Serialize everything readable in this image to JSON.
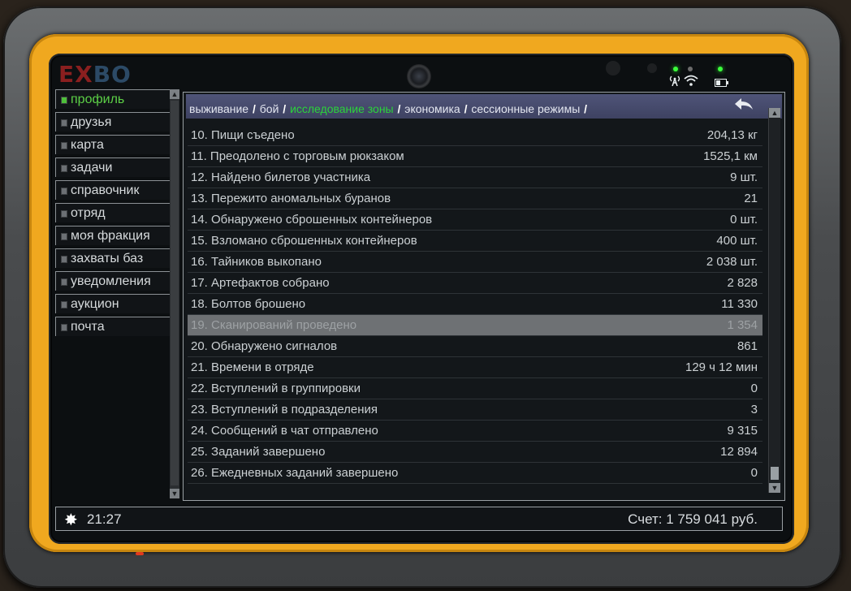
{
  "brand": {
    "ex": "EX",
    "bo": "BO"
  },
  "sidebar": {
    "items": [
      {
        "label": "профиль"
      },
      {
        "label": "друзья"
      },
      {
        "label": "карта"
      },
      {
        "label": "задачи"
      },
      {
        "label": "справочник"
      },
      {
        "label": "отряд"
      },
      {
        "label": "моя фракция"
      },
      {
        "label": "захваты баз"
      },
      {
        "label": "уведомления"
      },
      {
        "label": "аукцион"
      },
      {
        "label": "почта"
      }
    ]
  },
  "breadcrumbs": {
    "items": [
      {
        "label": "выживание"
      },
      {
        "label": "бой"
      },
      {
        "label": "исследование зоны"
      },
      {
        "label": "экономика"
      },
      {
        "label": "сессионные режимы"
      }
    ],
    "separator": "/",
    "active_color": "#2bd33b"
  },
  "stats": {
    "rows": [
      {
        "label": "10. Пищи съедено",
        "value": "204,13 кг"
      },
      {
        "label": "11. Преодолено с торговым рюкзаком",
        "value": "1525,1 км"
      },
      {
        "label": "12. Найдено билетов участника",
        "value": "9 шт."
      },
      {
        "label": "13. Пережито аномальных буранов",
        "value": "21"
      },
      {
        "label": "14. Обнаружено сброшенных контейнеров",
        "value": "0 шт."
      },
      {
        "label": "15. Взломано сброшенных контейнеров",
        "value": "400 шт."
      },
      {
        "label": "16. Тайников выкопано",
        "value": "2 038 шт."
      },
      {
        "label": "17. Артефактов собрано",
        "value": "2 828"
      },
      {
        "label": "18. Болтов брошено",
        "value": "11 330"
      },
      {
        "label": "19. Сканирований проведено",
        "value": "1 354"
      },
      {
        "label": "20. Обнаружено сигналов",
        "value": "861"
      },
      {
        "label": "21. Времени в отряде",
        "value": "129 ч 12 мин"
      },
      {
        "label": "22. Вступлений в группировки",
        "value": "0"
      },
      {
        "label": "23. Вступлений в подразделения",
        "value": "3"
      },
      {
        "label": "24. Сообщений в чат отправлено",
        "value": "9 315"
      },
      {
        "label": "25. Заданий завершено",
        "value": "12 894"
      },
      {
        "label": "26. Ежедневных заданий завершено",
        "value": "0"
      }
    ]
  },
  "footer": {
    "time": "21:27",
    "balance": "Счет: 1 759 041 руб."
  },
  "icons": {
    "back": "back-arrow-icon",
    "sun": "sun-icon",
    "signal": "antenna-icon",
    "wifi": "wifi-icon",
    "battery": "battery-icon"
  }
}
